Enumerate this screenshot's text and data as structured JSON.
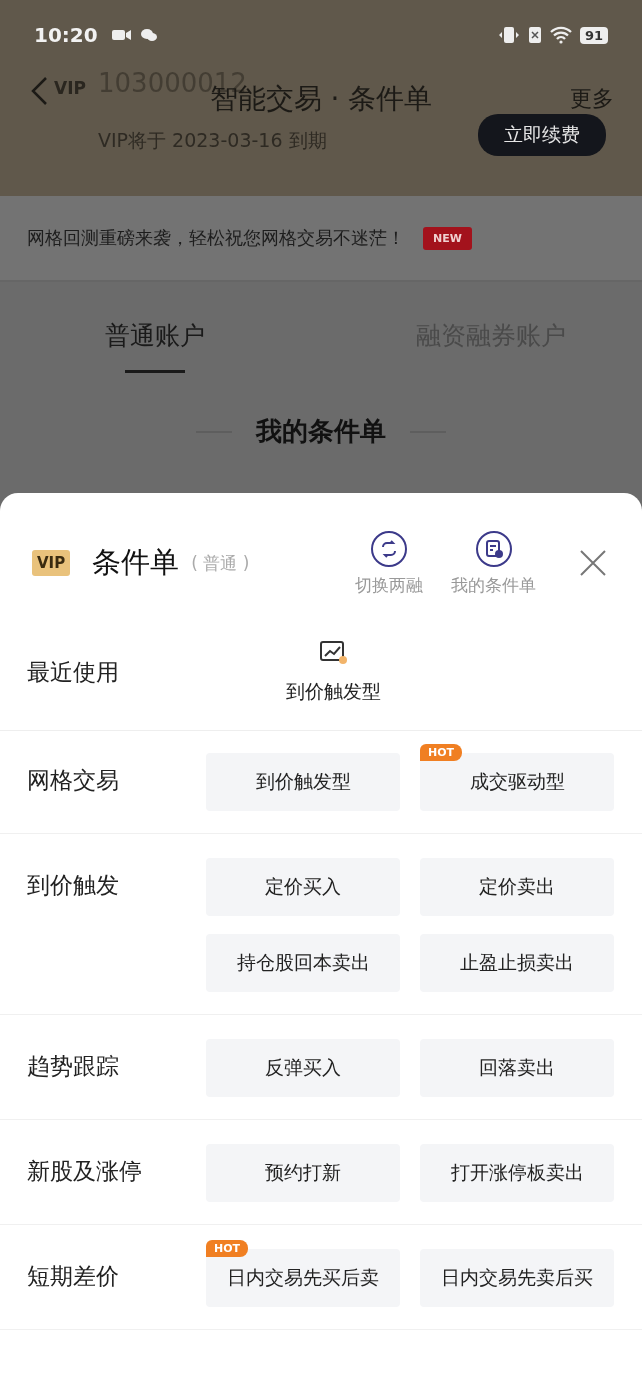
{
  "status_bar": {
    "time": "10:20",
    "battery": "91"
  },
  "header": {
    "vip_mark": "VIP",
    "account": "103000012",
    "title": "智能交易 · 条件单",
    "more": "更多",
    "expiry": "VIP将于 2023-03-16 到期",
    "renew": "立即续费"
  },
  "banner": {
    "text": "网格回测重磅来袭，轻松祝您网格交易不迷茫！",
    "badge": "NEW"
  },
  "tabs": [
    {
      "label": "普通账户",
      "selected": true
    },
    {
      "label": "融资融券账户",
      "selected": false
    }
  ],
  "section_title": "我的条件单",
  "sheet": {
    "vip_badge": "VIP",
    "title": "条件单",
    "subtitle": "( 普通 )",
    "actions": [
      {
        "kind": "switch",
        "label": "切换两融"
      },
      {
        "kind": "orders",
        "label": "我的条件单"
      }
    ],
    "recent": {
      "label": "最近使用",
      "items": [
        {
          "label": "到价触发型"
        }
      ]
    },
    "groups": [
      {
        "label": "网格交易",
        "options": [
          {
            "label": "到价触发型"
          },
          {
            "label": "成交驱动型",
            "badge": "HOT"
          }
        ]
      },
      {
        "label": "到价触发",
        "options": [
          {
            "label": "定价买入"
          },
          {
            "label": "定价卖出"
          },
          {
            "label": "持仓股回本卖出"
          },
          {
            "label": "止盈止损卖出"
          }
        ]
      },
      {
        "label": "趋势跟踪",
        "options": [
          {
            "label": "反弹买入"
          },
          {
            "label": "回落卖出"
          }
        ]
      },
      {
        "label": "新股及涨停",
        "options": [
          {
            "label": "预约打新"
          },
          {
            "label": "打开涨停板卖出"
          }
        ]
      },
      {
        "label": "短期差价",
        "options": [
          {
            "label": "日内交易先买后卖",
            "badge": "HOT"
          },
          {
            "label": "日内交易先卖后买"
          }
        ]
      }
    ]
  }
}
